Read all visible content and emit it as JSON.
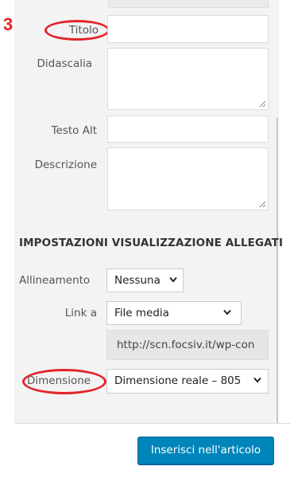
{
  "step_marker": "3",
  "fields": {
    "title_label": "Titolo",
    "title_value": "",
    "caption_label": "Didascalia",
    "caption_value": "",
    "alt_label": "Testo Alt",
    "alt_value": "",
    "description_label": "Descrizione",
    "description_value": ""
  },
  "settings": {
    "heading": "IMPOSTAZIONI VISUALIZZAZIONE ALLEGATI",
    "alignment_label": "Allineamento",
    "alignment_value": "Nessuna",
    "link_label": "Link a",
    "link_value": "File media",
    "link_url": "http://scn.focsiv.it/wp-con",
    "size_label": "Dimensione",
    "size_value": "Dimensione reale – 805"
  },
  "footer": {
    "insert_button": "Inserisci nell'articolo"
  },
  "colors": {
    "highlight": "#e3242b",
    "primary_button": "#0085ba",
    "panel_bg": "#f3f3f3"
  },
  "icons": {
    "select_arrow": "chevron-down-icon",
    "resize_handle": "resize-grip-icon"
  }
}
